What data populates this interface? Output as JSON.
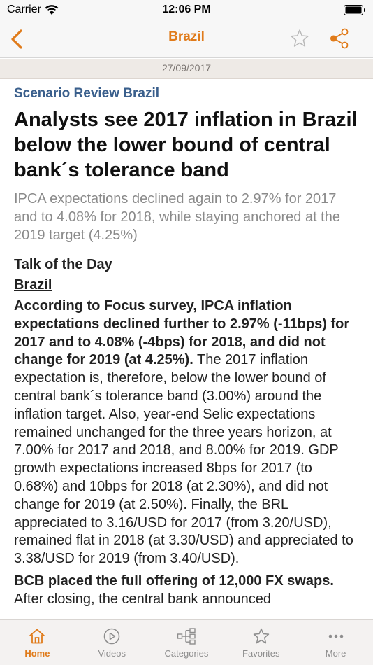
{
  "status": {
    "carrier": "Carrier",
    "time": "12:06 PM"
  },
  "nav": {
    "title": "Brazil"
  },
  "date": "27/09/2017",
  "article": {
    "section": "Scenario Review Brazil",
    "headline": "Analysts see 2017 inflation in Brazil below the lower bound of central bank´s tolerance band",
    "summary": "IPCA expectations declined again to 2.97% for 2017 and to 4.08% for 2018, while staying anchored at the 2019 target (4.25%)",
    "subhead": "Talk of the Day",
    "country": "Brazil",
    "para1_lead": "According to Focus survey, IPCA inflation expectations declined further to 2.97% (-11bps) for 2017 and to 4.08% (-4bps) for 2018, and did not change for 2019 (at 4.25%).",
    "para1_body": " The 2017 inflation expectation is, therefore, below the lower bound of central bank´s tolerance band (3.00%) around the inflation target. Also, year-end Selic expectations remained unchanged for the three years horizon, at 7.00% for 2017 and 2018, and 8.00% for 2019. GDP growth expectations increased 8bps for 2017 (to 0.68%) and 10bps for 2018 (at 2.30%), and did not change for 2019 (at 2.50%). Finally, the BRL appreciated to 3.16/USD for 2017 (from 3.20/USD), remained flat in 2018 (at 3.30/USD) and appreciated to 3.38/USD for 2019 (from 3.40/USD).",
    "para2_lead": "BCB placed the full offering of 12,000 FX swaps.",
    "para2_body": " After closing, the central bank announced"
  },
  "tabs": [
    {
      "label": "Home",
      "icon": "home-icon",
      "active": true
    },
    {
      "label": "Videos",
      "icon": "play-icon",
      "active": false
    },
    {
      "label": "Categories",
      "icon": "categories-icon",
      "active": false
    },
    {
      "label": "Favorites",
      "icon": "star-icon",
      "active": false
    },
    {
      "label": "More",
      "icon": "more-icon",
      "active": false
    }
  ],
  "colors": {
    "accent": "#e07b1a",
    "section": "#3a5f8c",
    "inactive": "#8d8d8d"
  }
}
